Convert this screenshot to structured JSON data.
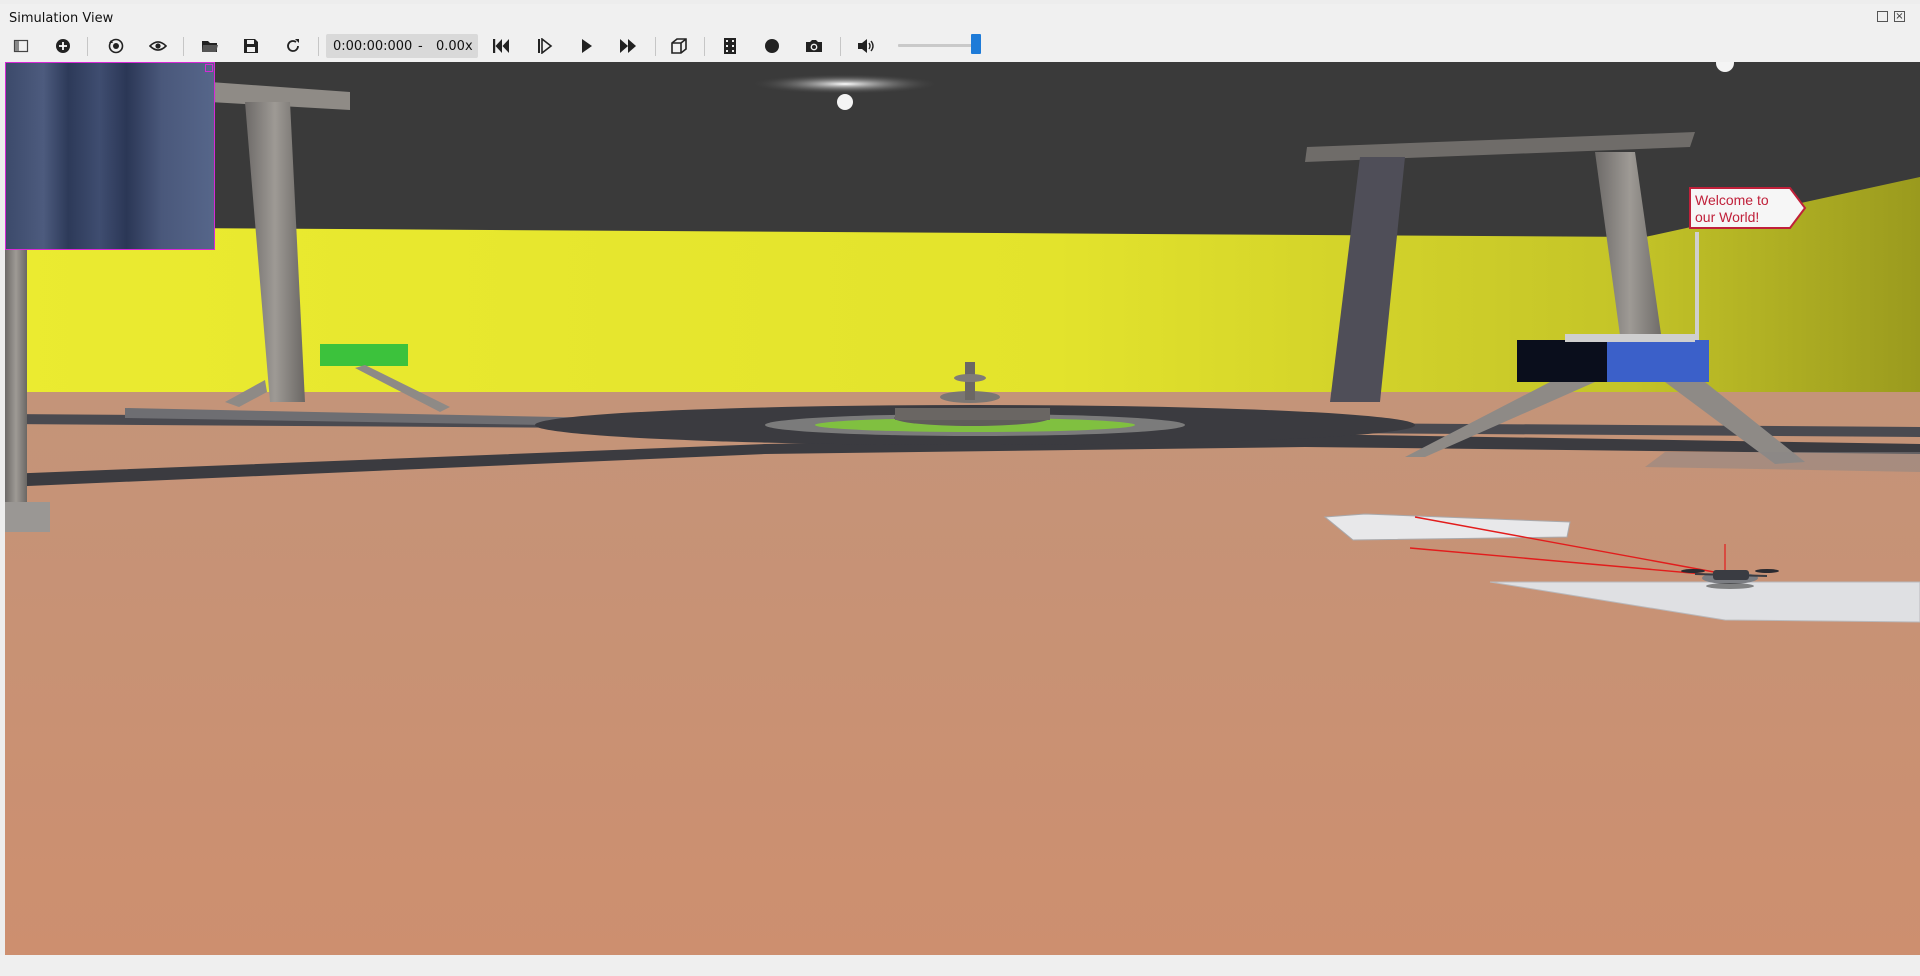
{
  "window": {
    "title": "Simulation View"
  },
  "toolbar": {
    "buttons": [
      {
        "name": "toggle-panel-button",
        "icon": "toggle-panel-icon"
      },
      {
        "name": "add-node-button",
        "icon": "add-circle-icon"
      },
      {
        "name": "change-view-button",
        "icon": "rotate-view-icon"
      },
      {
        "name": "eye-button",
        "icon": "eye-icon"
      },
      {
        "name": "open-world-button",
        "icon": "folder-open-icon"
      },
      {
        "name": "save-world-button",
        "icon": "save-icon"
      },
      {
        "name": "reload-world-button",
        "icon": "reload-icon"
      },
      {
        "name": "reset-simulation-button",
        "icon": "skip-back-icon"
      },
      {
        "name": "step-button",
        "icon": "step-icon"
      },
      {
        "name": "play-button",
        "icon": "play-icon"
      },
      {
        "name": "fast-forward-button",
        "icon": "fast-forward-icon"
      },
      {
        "name": "view-cube-button",
        "icon": "cube-icon"
      },
      {
        "name": "movie-button",
        "icon": "film-icon"
      },
      {
        "name": "record-button",
        "icon": "record-icon"
      },
      {
        "name": "screenshot-button",
        "icon": "camera-icon"
      },
      {
        "name": "sound-button",
        "icon": "volume-icon"
      }
    ],
    "time": "0:00:00:000",
    "time_separator": "-",
    "speed": "0.00x",
    "volume_level_fraction": 0.95
  },
  "scene": {
    "sign_text_line1": "Welcome to",
    "sign_text_line2": "our World!",
    "colors": {
      "sky": "#3a3a3a",
      "wall": "#e6e62e",
      "floor": "#c99172",
      "road": "#3b3b40",
      "overlay_border": "#d629d6",
      "accent": "#1e7bd8"
    }
  }
}
